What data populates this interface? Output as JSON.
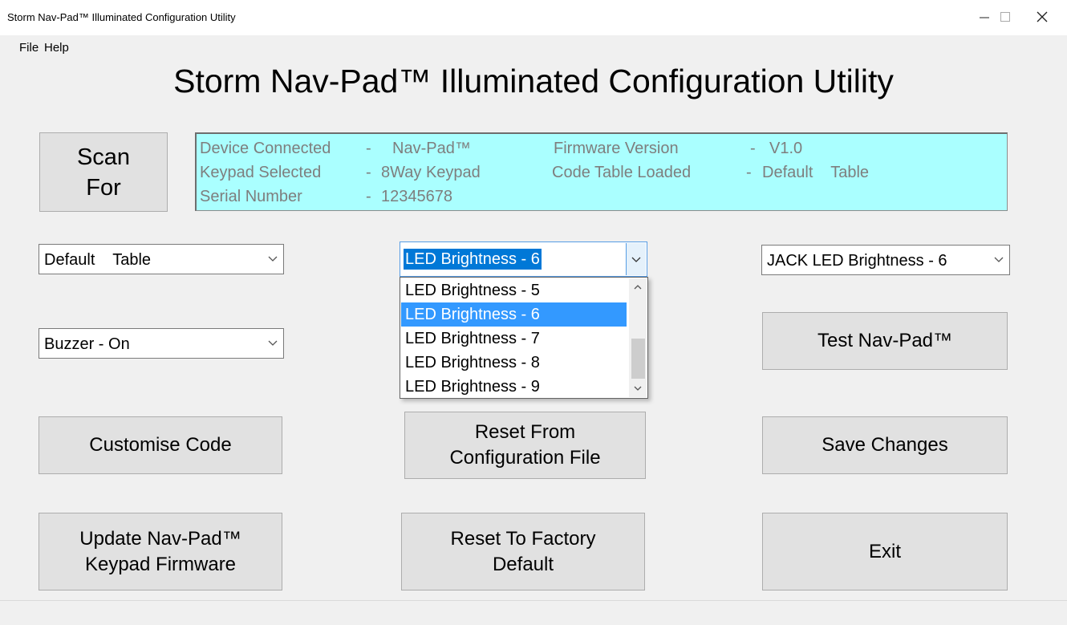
{
  "window": {
    "title": "Storm Nav-Pad™ Illuminated Configuration Utility",
    "controls": {
      "minimize": "minimize-icon",
      "maximize": "maximize-icon",
      "close": "close-icon"
    }
  },
  "menu": {
    "file": "File",
    "help": "Help"
  },
  "heading": "Storm Nav-Pad™ Illuminated Configuration Utility",
  "scan_button": "Scan\nFor",
  "info": {
    "device_label": "Device Connected",
    "device_sep": "-",
    "device_value": "Nav-Pad™",
    "firmware_label": "Firmware Version",
    "firmware_sep": "-",
    "firmware_value": "V1.0",
    "keypad_label": "Keypad Selected",
    "keypad_sep": "-",
    "keypad_value": "8Way Keypad",
    "code_label": "Code Table Loaded",
    "code_sep": "-",
    "code_value": "Default    Table",
    "serial_label": "Serial Number",
    "serial_sep": "-",
    "serial_value": "12345678"
  },
  "combos": {
    "table": "Default    Table",
    "led": "LED Brightness - 6",
    "jack": "JACK LED Brightness - 6",
    "buzzer": "Buzzer - On"
  },
  "led_options": [
    "LED Brightness - 5",
    "LED Brightness - 6",
    "LED Brightness - 7",
    "LED Brightness - 8",
    "LED Brightness - 9"
  ],
  "buttons": {
    "test": "Test Nav-Pad™",
    "customise": "Customise Code",
    "reset_config": "Reset From\nConfiguration File",
    "save": "Save Changes",
    "update_firmware": "Update Nav-Pad™\nKeypad Firmware",
    "reset_factory": "Reset To Factory\nDefault",
    "exit": "Exit"
  },
  "colors": {
    "info_panel_bg": "#aaffff",
    "selection": "#3399ff",
    "button_bg": "#e1e1e1"
  }
}
